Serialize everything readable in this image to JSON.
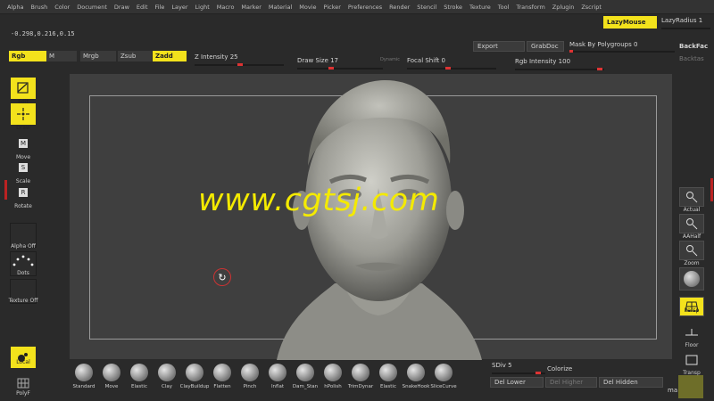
{
  "menubar": [
    "Alpha",
    "Brush",
    "Color",
    "Document",
    "Draw",
    "Edit",
    "File",
    "Layer",
    "Light",
    "Macro",
    "Marker",
    "Material",
    "Movie",
    "Picker",
    "Preferences",
    "Render",
    "Stencil",
    "Stroke",
    "Texture",
    "Tool",
    "Transform",
    "Zplugin",
    "Zscript"
  ],
  "coords": "-0.298,0.216,0.15",
  "topright": {
    "lazymouse": "LazyMouse",
    "lazyradius": "LazyRadius 1",
    "export": "Export",
    "grabdoc": "GrabDoc",
    "mask_by_polygroups": "Mask By Polygroups 0",
    "backface": "BackFac",
    "backface2": "Backtas"
  },
  "toolbar": {
    "rgb": "Rgb",
    "m": "M",
    "mrgb": "Mrgb",
    "zsub": "Zsub",
    "zadd": "Zadd",
    "z_intensity": "Z Intensity 25",
    "draw_size": "Draw Size 17",
    "dynamic": "Dynamic",
    "focal_shift": "Focal Shift 0",
    "rgb_intensity": "Rgb Intensity 100"
  },
  "left_tools": [
    {
      "label": "Edit",
      "active": true
    },
    {
      "label": "Draw",
      "active": true
    },
    {
      "label": "Move",
      "active": false
    },
    {
      "label": "Scale",
      "active": false
    },
    {
      "label": "Rotate",
      "active": false
    }
  ],
  "left_swatches": {
    "alpha": "Alpha Off",
    "dots": "Dots",
    "texture": "Texture Off"
  },
  "left_bottom": {
    "local": "Local",
    "polyf": "PolyF"
  },
  "right_tools": [
    {
      "label": "Actual",
      "active": false
    },
    {
      "label": "AAHalf",
      "active": false
    },
    {
      "label": "Zoom",
      "active": false
    },
    {
      "label": "",
      "active": false
    },
    {
      "label": "Persp",
      "active": true
    },
    {
      "label": "Floor",
      "active": false
    },
    {
      "label": "Transp",
      "active": false
    }
  ],
  "bottom_brushes": [
    "Standard",
    "Move",
    "Elastic",
    "Clay",
    "ClayBuildup",
    "Flatten",
    "Pinch",
    "Inflat",
    "Dam_Stan",
    "hPolish",
    "TrimDynar",
    "Elastic",
    "SnakeHook",
    "SliceCurve"
  ],
  "bottom_right": {
    "sdiv": "SDiv 5",
    "colorize": "Colorize",
    "del_lower": "Del Lower",
    "del_higher": "Del Higher",
    "del_hidden": "Del Hidden",
    "ma": "ma"
  },
  "watermark": "www.cgtsj.com",
  "colors": {
    "accent": "#f3e21c",
    "slider": "#dd3333",
    "canvas": "#3f3f3f"
  }
}
